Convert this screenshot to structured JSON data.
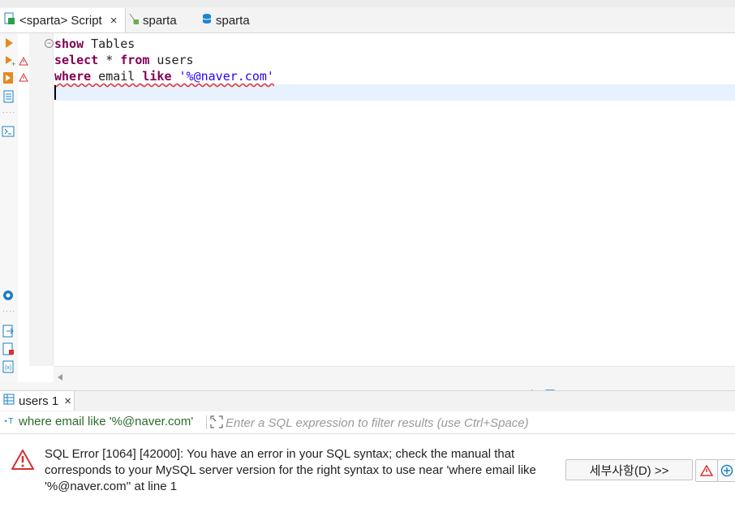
{
  "tabs": {
    "script": {
      "label": "<sparta> Script",
      "close": "×"
    },
    "sparta1": {
      "label": "sparta"
    },
    "sparta2": {
      "label": "sparta"
    }
  },
  "editor": {
    "line1": {
      "kw": "show",
      "rest": " Tables"
    },
    "line2": {
      "kw1": "select",
      "mid": " * ",
      "kw2": "from",
      "rest": " users"
    },
    "line3": {
      "kw1": "where",
      "mid": " email ",
      "kw2": "like",
      "sp": " ",
      "str": "'%@naver.com'"
    },
    "fold": "−"
  },
  "results": {
    "tab_label": "users 1",
    "tab_close": "×",
    "query": "where email like '%@naver.com'",
    "filter_placeholder": "Enter a SQL expression to filter results (use Ctrl+Space)",
    "error_message": "SQL Error [1064] [42000]: You have an error in your SQL syntax; check the manual that corresponds to your MySQL server version for the right syntax to use near 'where email like '%@naver.com'' at line 1",
    "details_button": "세부사항(D) >>"
  },
  "colors": {
    "keyword": "#7f0055",
    "string": "#2a00ff",
    "error": "#d9302f",
    "accent": "#1a7fc1"
  }
}
